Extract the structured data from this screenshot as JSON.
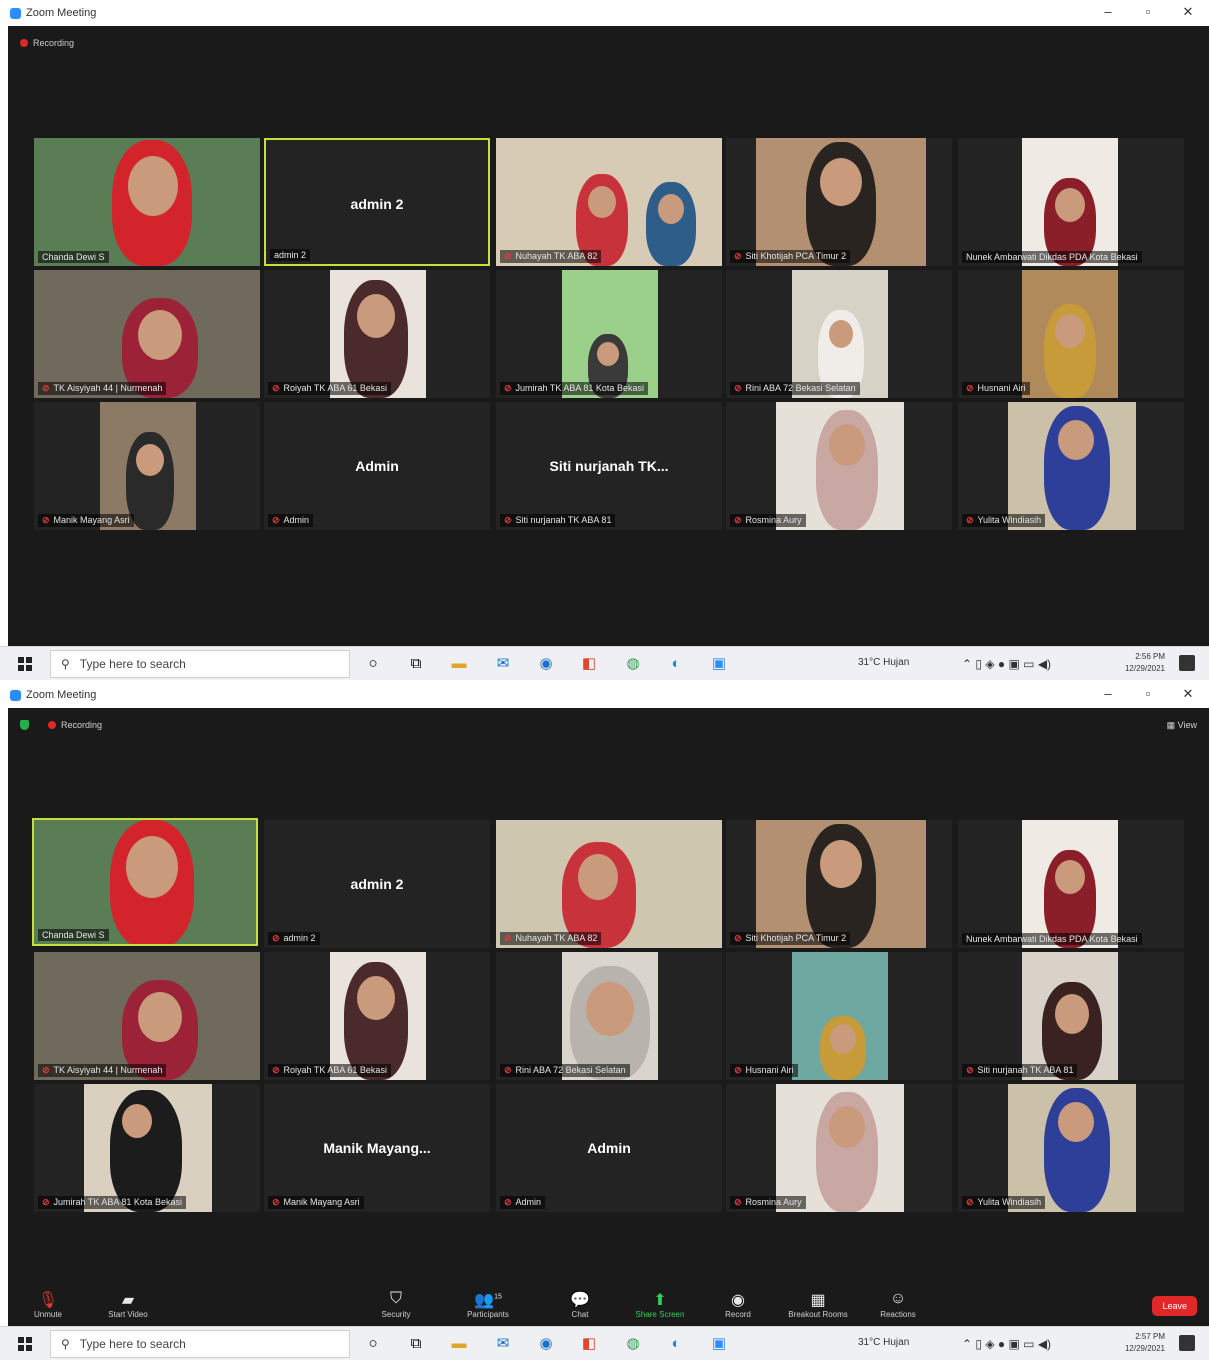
{
  "window": {
    "title": "Zoom Meeting",
    "minimize": "–",
    "restore": "▫",
    "close": "✕"
  },
  "recording_label": "Recording",
  "view_label": "View",
  "shot1": {
    "tiles": [
      {
        "label": "Chanda Dewi S",
        "mic": false
      },
      {
        "label": "admin 2",
        "center_name": "admin 2",
        "mic": false,
        "active": true
      },
      {
        "label": "Nuhayah  TK ABA 82",
        "mic": true
      },
      {
        "label": "Siti Khotijah PCA Timur 2",
        "mic": true
      },
      {
        "label": "Nunek Ambarwati Dikdas PDA Kota Bekasi",
        "mic": false
      },
      {
        "label": "TK Aisyiyah 44 | Nurmenah",
        "mic": true
      },
      {
        "label": "Roiyah TK ABA 61 Bekasi",
        "mic": true
      },
      {
        "label": "Jumirah TK ABA 81 Kota Bekasi",
        "mic": true
      },
      {
        "label": "Rini  ABA 72 Bekasi Selatan",
        "mic": true
      },
      {
        "label": "Husnani Airi",
        "mic": true
      },
      {
        "label": "Manik Mayang Asri",
        "mic": true
      },
      {
        "label": "Admin",
        "center_name": "Admin",
        "mic": true
      },
      {
        "label": "Siti nurjanah TK ABA 81",
        "center_name": "Siti nurjanah TK...",
        "mic": true
      },
      {
        "label": "Rosmina Aury",
        "mic": true
      },
      {
        "label": "Yulita Windiasih",
        "mic": true
      }
    ],
    "clock": {
      "time": "2:56 PM",
      "date": "12/29/2021"
    }
  },
  "shot2": {
    "tiles": [
      {
        "label": "Chanda Dewi S",
        "mic": false,
        "active": true
      },
      {
        "label": "admin 2",
        "center_name": "admin 2",
        "mic": true
      },
      {
        "label": "Nuhayah  TK ABA 82",
        "mic": true
      },
      {
        "label": "Siti Khotijah PCA Timur 2",
        "mic": true
      },
      {
        "label": "Nunek Ambarwati Dikdas PDA Kota Bekasi",
        "mic": false
      },
      {
        "label": "TK Aisyiyah 44 | Nurmenah",
        "mic": true
      },
      {
        "label": "Roiyah TK ABA 61 Bekasi",
        "mic": true
      },
      {
        "label": "Rini  ABA 72 Bekasi Selatan",
        "mic": true
      },
      {
        "label": "Husnani Airi",
        "mic": true
      },
      {
        "label": "Siti nurjanah TK ABA 81",
        "mic": true
      },
      {
        "label": "Jumirah TK ABA 81 Kota Bekasi",
        "mic": true
      },
      {
        "label": "Manik Mayang Asri",
        "center_name": "Manik  Mayang...",
        "mic": true
      },
      {
        "label": "Admin",
        "center_name": "Admin",
        "mic": true
      },
      {
        "label": "Rosmina Aury",
        "mic": true
      },
      {
        "label": "Yulita Windiasih",
        "mic": true
      }
    ],
    "clock": {
      "time": "2:57 PM",
      "date": "12/29/2021"
    }
  },
  "toolbar": {
    "unmute": "Unmute",
    "start_video": "Start Video",
    "security": "Security",
    "participants": "Participants",
    "participants_count": "15",
    "chat": "Chat",
    "share_screen": "Share Screen",
    "record": "Record",
    "breakout_rooms": "Breakout Rooms",
    "reactions": "Reactions",
    "leave": "Leave"
  },
  "taskbar": {
    "search_placeholder": "Type here to search",
    "weather": "31°C  Hujan",
    "apps": [
      "task-view",
      "file-explorer",
      "mail",
      "windows-store",
      "telegram",
      "office",
      "chrome",
      "edge",
      "zoom"
    ]
  },
  "colors": {
    "meeting_bg": "#1a1a1a",
    "active_speaker": "#c6e03a",
    "leave": "#e02828",
    "zoom_blue": "#2d8cff",
    "share_green": "#2fd05a"
  }
}
